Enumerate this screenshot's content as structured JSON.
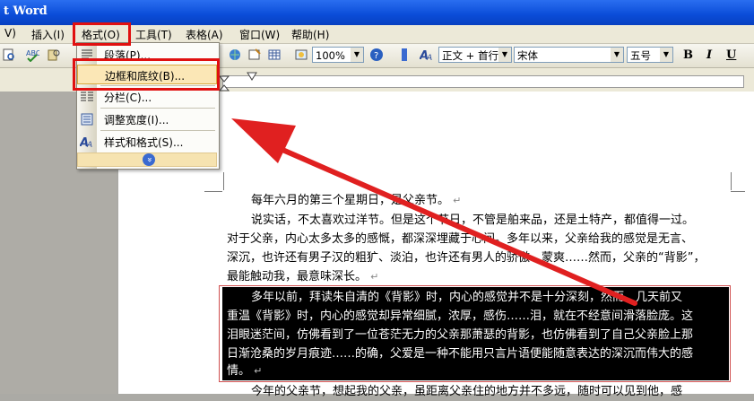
{
  "window": {
    "title": "t Word"
  },
  "menubar": {
    "items": [
      {
        "label": "V)"
      },
      {
        "label": "插入(I)"
      },
      {
        "label": "格式(O)"
      },
      {
        "label": "工具(T)"
      },
      {
        "label": "表格(A)"
      },
      {
        "label": "窗口(W)"
      },
      {
        "label": "帮助(H)"
      }
    ]
  },
  "toolbar": {
    "zoom": "100%",
    "style": "正文 + 首行",
    "font": "宋体",
    "size": "五号",
    "bold": "B",
    "italic": "I",
    "underline": "U"
  },
  "format_menu": {
    "items": [
      {
        "label": "段落(P)..."
      },
      {
        "label": "边框和底纹(B)..."
      },
      {
        "label": "分栏(C)..."
      },
      {
        "label": "调整宽度(I)..."
      },
      {
        "label": "样式和格式(S)..."
      }
    ],
    "expand": "»"
  },
  "document": {
    "paragraphs": [
      "每年六月的第三个星期日，是父亲节。",
      "说实话，不太喜欢过洋节。但是这个节日，不管是舶来品，还是土特产，都值得一过。",
      "对于父亲，内心太多太多的感慨，都深深埋藏于心间。多年以来，父亲给我的感觉是无言、",
      "深沉，也许还有男子汉的粗犷、淡泊，也许还有男人的骄傲、蒙爽……然而，父亲的“背影”，",
      "最能触动我，最意味深长。"
    ],
    "selected_paragraph": [
      "多年以前，拜读朱自清的《背影》时，内心的感觉并不是十分深刻，然而，几天前又",
      "重温《背影》时，内心的感觉却异常细腻，浓厚，感伤……泪，就在不经意间滑落脸庞。这",
      "泪眼迷茫间，仿佛看到了一位苍茫无力的父亲那萧瑟的背影，也仿佛看到了自己父亲脸上那",
      "日渐沧桑的岁月痕迹……的确，父爱是一种不能用只言片语便能随意表达的深沉而伟大的感",
      "情。"
    ],
    "next_line": "今年的父亲节，想起我的父亲，虽距离父亲住的地方并不多远，随时可以见到他，感"
  },
  "colors": {
    "annotation_red": "#e01010",
    "title_bar": "#0a4cd8",
    "menu_highlight": "#fbe7b6"
  }
}
